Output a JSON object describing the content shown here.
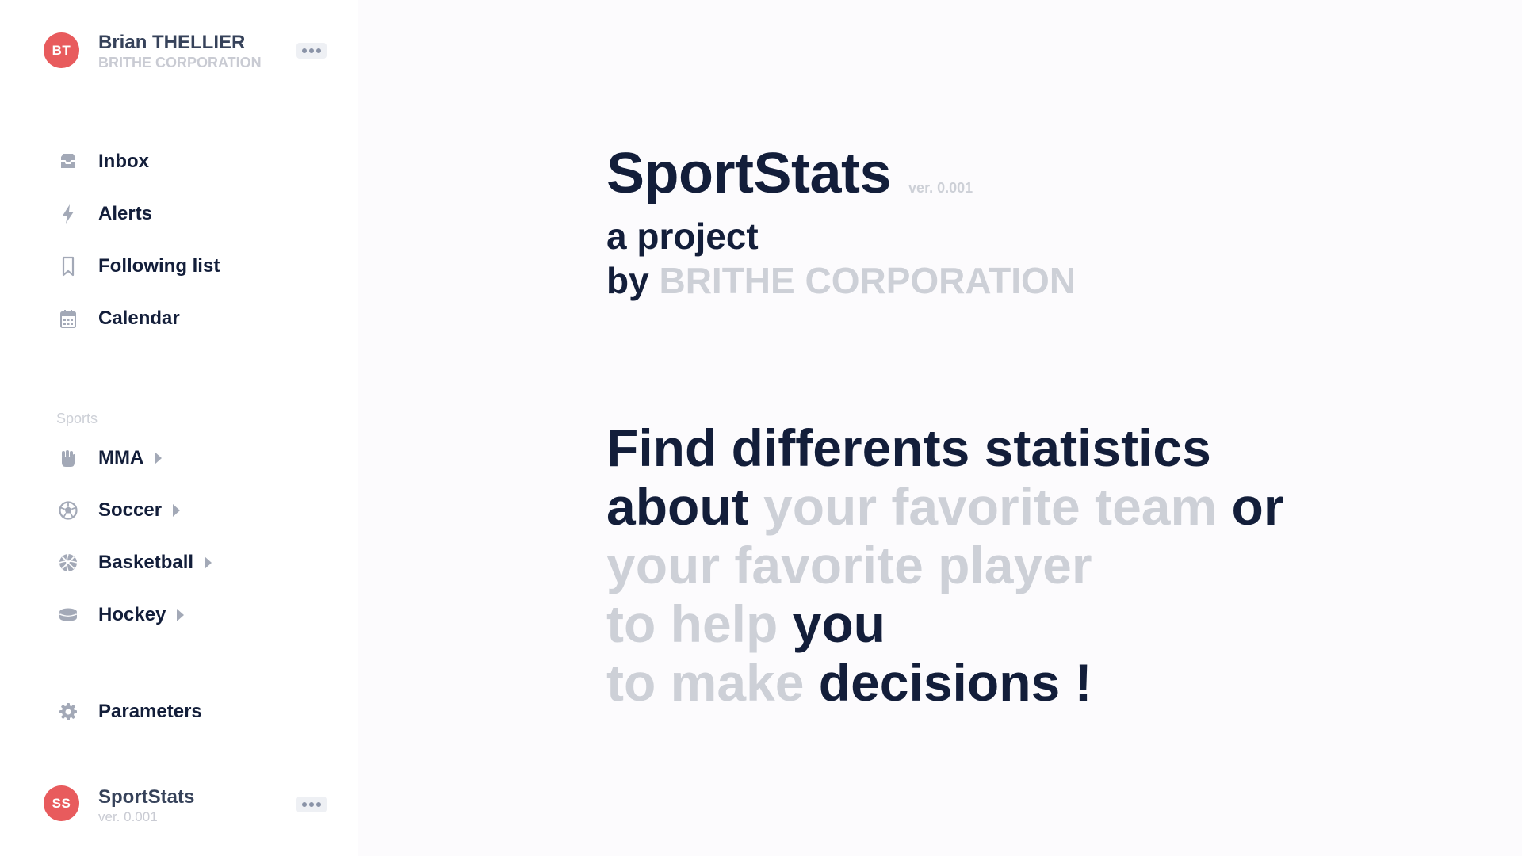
{
  "user": {
    "initials": "BT",
    "name": "Brian THELLIER",
    "company": "BRITHE CORPORATION"
  },
  "nav": {
    "items": [
      {
        "label": "Inbox",
        "icon": "inbox-icon"
      },
      {
        "label": "Alerts",
        "icon": "bolt-icon"
      },
      {
        "label": "Following list",
        "icon": "bookmark-icon"
      },
      {
        "label": "Calendar",
        "icon": "calendar-icon"
      }
    ]
  },
  "sports": {
    "section_label": "Sports",
    "items": [
      {
        "label": "MMA",
        "icon": "fist-icon"
      },
      {
        "label": "Soccer",
        "icon": "soccer-ball-icon"
      },
      {
        "label": "Basketball",
        "icon": "basketball-icon"
      },
      {
        "label": "Hockey",
        "icon": "hockey-puck-icon"
      }
    ]
  },
  "settings": {
    "label": "Parameters",
    "icon": "gear-icon"
  },
  "app_footer": {
    "initials": "SS",
    "name": "SportStats",
    "version": "ver. 0.001"
  },
  "hero": {
    "title": "SportStats",
    "version": "ver. 0.001",
    "line1": "a project",
    "line2_prefix": "by",
    "line2_company": "BRITHE CORPORATION"
  },
  "tagline": {
    "l1": "Find differents statistics",
    "l2_a": "about",
    "l2_b": "your favorite team",
    "l2_c": "or",
    "l3": "your favorite player",
    "l4_a": "to help",
    "l4_b": "you",
    "l5_a": "to make",
    "l5_b": "decisions !"
  },
  "colors": {
    "accent": "#e85b5d",
    "text_dark": "#131e3a",
    "text_muted": "#cdd0d7",
    "icon_gray": "#a3a9b7",
    "background": "#fcfbfd"
  }
}
